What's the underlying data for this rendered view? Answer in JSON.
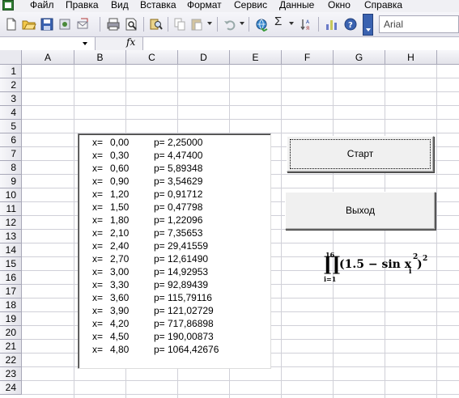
{
  "menu": {
    "items": [
      "Файл",
      "Правка",
      "Вид",
      "Вставка",
      "Формат",
      "Сервис",
      "Данные",
      "Окно",
      "Справка"
    ]
  },
  "toolbar": {
    "font_name": "Arial",
    "sigma_symbol": "Σ"
  },
  "formula_bar": {
    "fx_label": "fx"
  },
  "sheet": {
    "columns": [
      "A",
      "B",
      "C",
      "D",
      "E",
      "F",
      "G",
      "H"
    ],
    "rows": [
      "1",
      "2",
      "3",
      "4",
      "5",
      "6",
      "7",
      "8",
      "9",
      "10",
      "11",
      "12",
      "13",
      "14",
      "15",
      "16",
      "17",
      "18",
      "19",
      "20",
      "21",
      "22",
      "23",
      "24"
    ]
  },
  "listbox": {
    "x_label": "x=",
    "p_label": "p=",
    "rows": [
      {
        "x": "0,00",
        "p": "2,25000"
      },
      {
        "x": "0,30",
        "p": "4,47400"
      },
      {
        "x": "0,60",
        "p": "5,89348"
      },
      {
        "x": "0,90",
        "p": "3,54629"
      },
      {
        "x": "1,20",
        "p": "0,91712"
      },
      {
        "x": "1,50",
        "p": "0,47798"
      },
      {
        "x": "1,80",
        "p": "1,22096"
      },
      {
        "x": "2,10",
        "p": "7,35653"
      },
      {
        "x": "2,40",
        "p": "29,41559"
      },
      {
        "x": "2,70",
        "p": "12,61490"
      },
      {
        "x": "3,00",
        "p": "14,92953"
      },
      {
        "x": "3,30",
        "p": "92,89439"
      },
      {
        "x": "3,60",
        "p": "115,79116"
      },
      {
        "x": "3,90",
        "p": "121,02729"
      },
      {
        "x": "4,20",
        "p": "717,86898"
      },
      {
        "x": "4,50",
        "p": "190,00873"
      },
      {
        "x": "4,80",
        "p": "1064,42676"
      }
    ]
  },
  "buttons": {
    "start": "Старт",
    "exit": "Выход"
  },
  "formula": {
    "upper": "16",
    "lower": "i=1",
    "body": "(1.5 − sin x",
    "sub": "i",
    "inner_exp": "2",
    "outer_exp": "2"
  }
}
